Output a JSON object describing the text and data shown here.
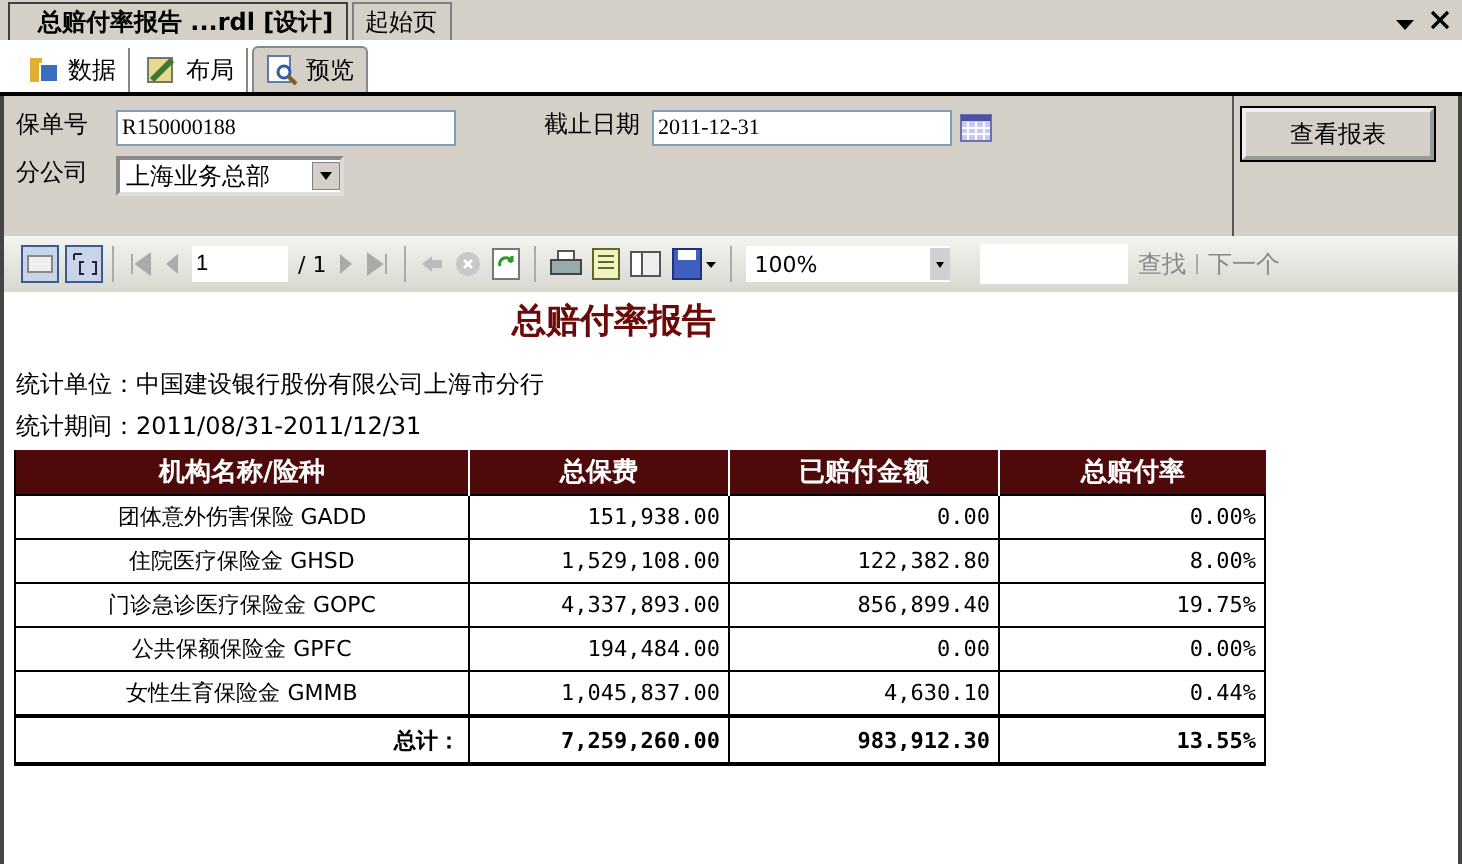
{
  "doc_tabs": [
    {
      "label": "总赔付率报告 ...rdl [设计]",
      "selected": true
    },
    {
      "label": "起始页",
      "selected": false
    }
  ],
  "view_tabs": [
    {
      "label": "数据",
      "kind": "data",
      "selected": false
    },
    {
      "label": "布局",
      "kind": "layout",
      "selected": false
    },
    {
      "label": "预览",
      "kind": "preview",
      "selected": true
    }
  ],
  "params": {
    "policy_no": {
      "label": "保单号",
      "value": "R150000188"
    },
    "end_date": {
      "label": "截止日期",
      "value": "2011-12-31"
    },
    "branch": {
      "label": "分公司",
      "value": "上海业务总部"
    },
    "view_button": "查看报表"
  },
  "toolbar": {
    "page": "1",
    "page_total": "/ 1",
    "zoom": "100%",
    "find": "查找",
    "next": "下一个"
  },
  "report": {
    "title": "总赔付率报告",
    "unit": "统计单位：中国建设银行股份有限公司上海市分行",
    "period": "统计期间：2011/08/31-2011/12/31",
    "columns": [
      "机构名称/险种",
      "总保费",
      "已赔付金额",
      "总赔付率"
    ],
    "rows": [
      {
        "cells": [
          "团体意外伤害保险 GADD",
          "151,938.00",
          "0.00",
          "0.00%"
        ]
      },
      {
        "cells": [
          "住院医疗保险金 GHSD",
          "1,529,108.00",
          "122,382.80",
          "8.00%"
        ]
      },
      {
        "cells": [
          "门诊急诊医疗保险金 GOPC",
          "4,337,893.00",
          "856,899.40",
          "19.75%"
        ]
      },
      {
        "cells": [
          "公共保额保险金 GPFC",
          "194,484.00",
          "0.00",
          "0.00%"
        ]
      },
      {
        "cells": [
          "女性生育保险金 GMMB",
          "1,045,837.00",
          "4,630.10",
          "0.44%"
        ]
      }
    ],
    "total": [
      "总计：",
      "7,259,260.00",
      "983,912.30",
      "13.55%"
    ]
  }
}
